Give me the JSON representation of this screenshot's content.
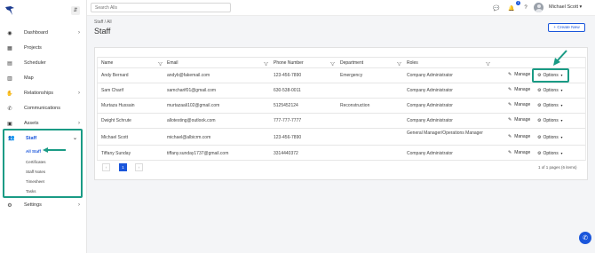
{
  "sidebar": {
    "items": [
      {
        "label": "Dashboard",
        "icon": "dashboard-icon",
        "chevron": "›"
      },
      {
        "label": "Projects",
        "icon": "projects-icon",
        "chevron": ""
      },
      {
        "label": "Scheduler",
        "icon": "calendar-icon",
        "chevron": ""
      },
      {
        "label": "Map",
        "icon": "map-icon",
        "chevron": ""
      },
      {
        "label": "Relationships",
        "icon": "handshake-icon",
        "chevron": "›"
      },
      {
        "label": "Communications",
        "icon": "phone-icon",
        "chevron": ""
      },
      {
        "label": "Assets",
        "icon": "assets-icon",
        "chevron": "›"
      }
    ],
    "staff": {
      "label": "Staff",
      "icon": "users-icon",
      "chevron": "⌄",
      "sub_items": [
        "All Staff",
        "Certificates",
        "Staff Notes",
        "Timesheet",
        "Tasks"
      ]
    },
    "settings": {
      "label": "Settings",
      "icon": "gear-icon",
      "chevron": "›"
    },
    "collapse_glyph": "⇵"
  },
  "topbar": {
    "search_placeholder": "Search Alls",
    "notification_count": "1",
    "user_name": "Michael Scott"
  },
  "header": {
    "breadcrumb": "Staff / All",
    "title": "Staff",
    "create_button": "+ Create New"
  },
  "table": {
    "columns": [
      "Name",
      "Email",
      "Phone Number",
      "Department",
      "Roles"
    ],
    "rows": [
      {
        "name": "Andy Bernard",
        "email": "andyb@fakemail.com",
        "phone": "123-456-7890",
        "department": "Emergency",
        "roles": "Company Administrator"
      },
      {
        "name": "Sam Charif",
        "email": "samcharif01@gmail.com",
        "phone": "630-538-0011",
        "department": "",
        "roles": "Company Administrator"
      },
      {
        "name": "Murtaza Hussain",
        "email": "murtazaali102@gmail.com",
        "phone": "5125452124",
        "department": "Reconstruction",
        "roles": "Company Administrator"
      },
      {
        "name": "Dwight Schrute",
        "email": "allotesting@outlook.com",
        "phone": "777-777-7777",
        "department": "",
        "roles": "Company Administrator"
      },
      {
        "name": "Michael Scott",
        "email": "michael@albicrm.com",
        "phone": "123-456-7890",
        "department": "",
        "roles": "General Manager/Operations Manager"
      },
      {
        "name": "Tiffany Sunday",
        "email": "tiffany.sunday1737@gmail.com",
        "phone": "3314440372",
        "department": "",
        "roles": "Company Administrator"
      }
    ],
    "manage_label": "Manage",
    "options_label": "Options"
  },
  "pagination": {
    "prev": "‹",
    "current": "1",
    "next": "›",
    "info": "1 of 1 pages (6 items)"
  },
  "colors": {
    "accent": "#1a56db",
    "highlight": "#1a9b85"
  }
}
